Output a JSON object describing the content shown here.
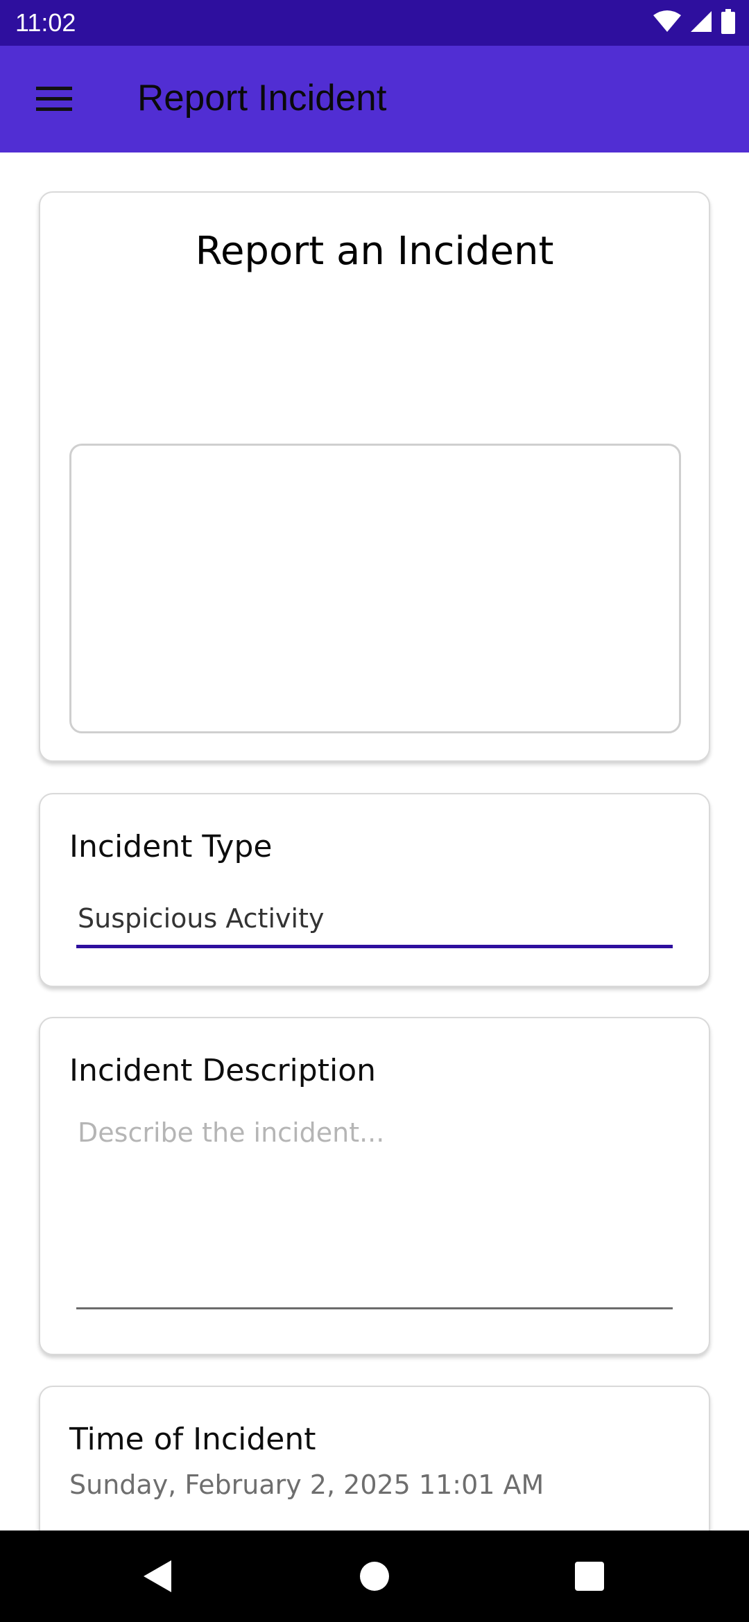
{
  "status_bar": {
    "time": "11:02",
    "icons": [
      "wifi-icon",
      "signal-icon",
      "battery-icon"
    ]
  },
  "app_bar": {
    "title": "Report Incident",
    "menu_icon": "hamburger-menu-icon",
    "background": "#512ed3"
  },
  "hero": {
    "title": "Report an Incident"
  },
  "incident_type": {
    "label": "Incident Type",
    "value": "Suspicious Activity",
    "accent": "#2e0f9e"
  },
  "incident_description": {
    "label": "Incident Description",
    "placeholder": "Describe the incident...",
    "value": ""
  },
  "time_of_incident": {
    "label": "Time of Incident",
    "value": "Sunday, February 2, 2025 11:01 AM"
  },
  "nav_bar": {
    "buttons": [
      "back-icon",
      "home-icon",
      "recents-icon"
    ]
  }
}
